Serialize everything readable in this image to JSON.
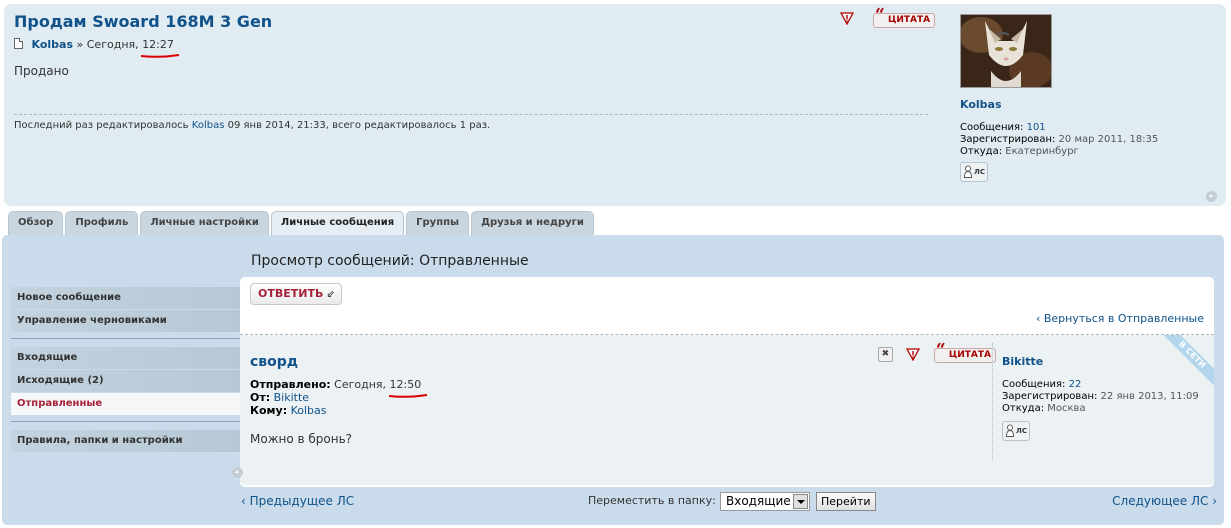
{
  "top_post": {
    "title": "Продам Swoard 168M 3 Gen",
    "author": "Kolbas",
    "separator": "»",
    "time_prefix": "Сегодня,",
    "time": "12:27",
    "text": "Продано",
    "edit_prefix": "Последний раз редактировалось",
    "edit_author": "Kolbas",
    "edit_suffix": "09 янв 2014, 21:33, всего редактировалось 1 раз.",
    "quote_label": "ЦИТАТА",
    "profile": {
      "name": "Kolbas",
      "posts_label": "Сообщения:",
      "posts_value": "101",
      "registered_label": "Зарегистрирован:",
      "registered_value": "20 мар 2011, 18:35",
      "from_label": "Откуда:",
      "from_value": "Екатеринбург",
      "pm_label": "ЛС"
    }
  },
  "tabs": [
    {
      "label": "Обзор"
    },
    {
      "label": "Профиль"
    },
    {
      "label": "Личные настройки"
    },
    {
      "label": "Личные сообщения",
      "active": true
    },
    {
      "label": "Группы"
    },
    {
      "label": "Друзья и недруги"
    }
  ],
  "ucp": {
    "title": "Просмотр сообщений: Отправленные",
    "menu_group1": [
      "Новое сообщение",
      "Управление черновиками"
    ],
    "menu_group2": [
      "Входящие",
      "Исходящие (2)",
      "Отправленные"
    ],
    "menu_group3": [
      "Правила, папки и настройки"
    ],
    "reply_label": "ОТВЕТИТЬ",
    "back_link": "Вернуться в Отправленные"
  },
  "message": {
    "subject": "сворд",
    "sent_label": "Отправлено:",
    "sent_prefix": "Сегодня,",
    "sent_time": "12:50",
    "from_label": "От:",
    "from_value": "Bikitte",
    "to_label": "Кому:",
    "to_value": "Kolbas",
    "text": "Можно в бронь?",
    "quote_label": "ЦИТАТА",
    "online_badge": "В СЕТИ",
    "profile": {
      "name": "Bikitte",
      "posts_label": "Сообщения:",
      "posts_value": "22",
      "registered_label": "Зарегистрирован:",
      "registered_value": "22 янв 2013, 11:09",
      "from_label": "Откуда:",
      "from_value": "Москва",
      "pm_label": "ЛС"
    }
  },
  "bottom": {
    "prev_link": "Предыдущее ЛС",
    "next_link": "Следующее ЛС",
    "move_label": "Переместить в папку:",
    "folder_selected": "Входящие",
    "go_label": "Перейти"
  },
  "colors": {
    "post_bg": "#e1ebf2",
    "panel_bg": "#cadceb",
    "link": "#105289",
    "accent_red": "#a51f38"
  }
}
